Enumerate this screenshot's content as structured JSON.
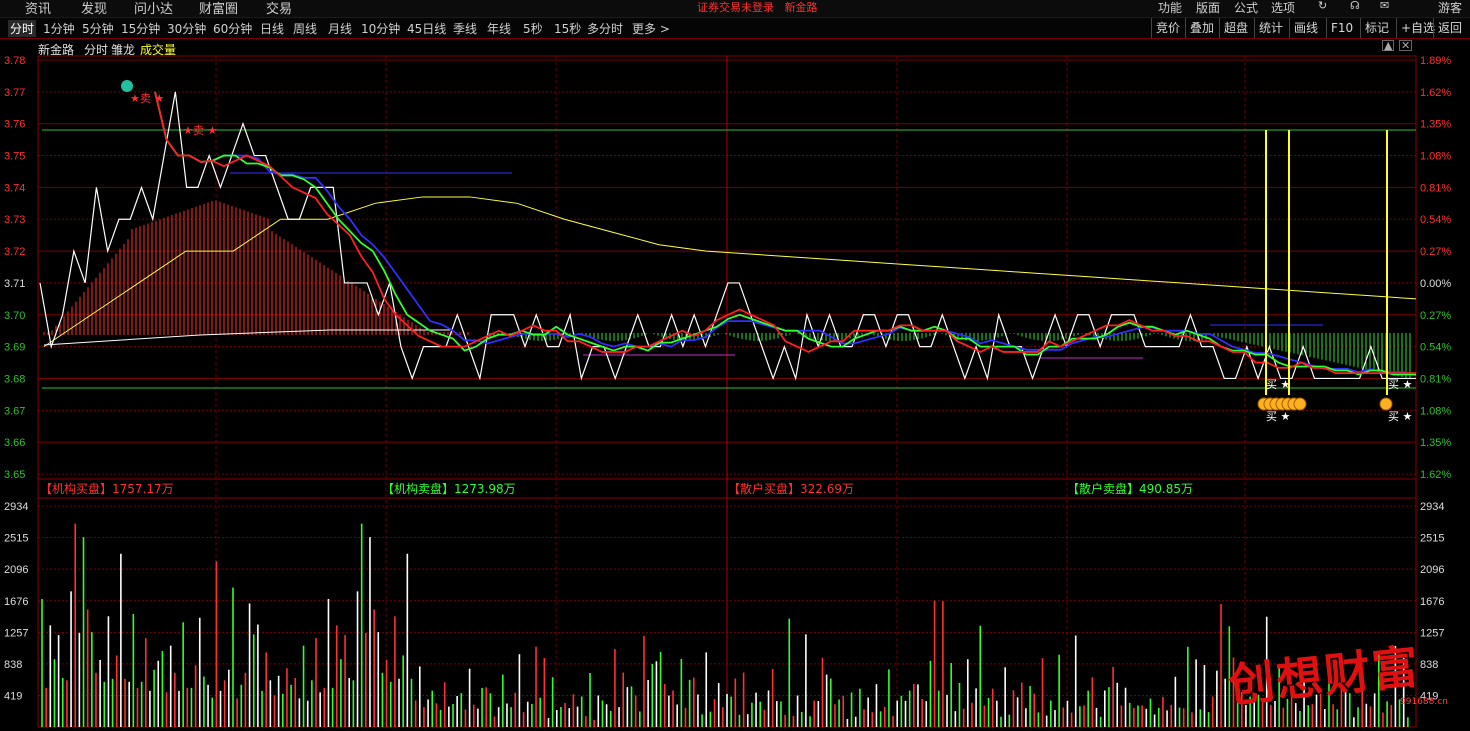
{
  "top_menu": {
    "left_items": [
      "资讯",
      "发现",
      "问小达",
      "财富圈",
      "交易"
    ],
    "warning": "证券交易未登录",
    "stock_name_link": "新金路",
    "right_items": [
      "功能",
      "版面",
      "公式",
      "选项",
      "游客"
    ]
  },
  "toolbar": {
    "timeframes": [
      "分时",
      "1分钟",
      "5分钟",
      "15分钟",
      "30分钟",
      "60分钟",
      "日线",
      "周线",
      "月线",
      "10分钟",
      "45日线",
      "季线",
      "年线",
      "5秒",
      "15秒",
      "多分时",
      "更多 >"
    ],
    "active": "分时",
    "right_buttons": [
      "竞价",
      "叠加",
      "超盘",
      "统计",
      "画线",
      "F10",
      "标记",
      "+自选",
      "返回"
    ]
  },
  "info_bar": {
    "stock": "新金路",
    "mode": "分时",
    "indicator": "雏龙",
    "volume_label": "成交量"
  },
  "price_axis": {
    "left": [
      "3.78",
      "3.77",
      "3.76",
      "3.75",
      "3.74",
      "3.73",
      "3.72",
      "3.71",
      "3.70",
      "3.69",
      "3.68",
      "3.67",
      "3.66",
      "3.65"
    ],
    "right": [
      "1.89%",
      "1.62%",
      "1.35%",
      "1.08%",
      "0.81%",
      "0.54%",
      "0.27%",
      "0.00%",
      "0.27%",
      "0.54%",
      "0.81%",
      "1.08%",
      "1.35%",
      "1.62%"
    ]
  },
  "volume_axis": [
    "2934",
    "2515",
    "2096",
    "1676",
    "1257",
    "838",
    "419"
  ],
  "flow_labels": [
    {
      "text": "【机构买盘】",
      "value": "1757.17万",
      "color": "#ff3030"
    },
    {
      "text": "【机构卖盘】",
      "value": "1273.98万",
      "color": "#30ff30"
    },
    {
      "text": "【散户买盘】",
      "value": "322.69万",
      "color": "#ff3030"
    },
    {
      "text": "【散户卖盘】",
      "value": "490.85万",
      "color": "#30ff30"
    }
  ],
  "signals": {
    "sell": "卖",
    "buy": "买",
    "star": "★"
  },
  "watermark": {
    "text": "创想财富",
    "url": "991688.cn"
  },
  "chart_data": {
    "type": "line",
    "prev_close": 3.71,
    "ylim": [
      3.65,
      3.78
    ],
    "price_series": [
      3.71,
      3.69,
      3.7,
      3.72,
      3.71,
      3.74,
      3.72,
      3.73,
      3.73,
      3.74,
      3.73,
      3.75,
      3.77,
      3.74,
      3.74,
      3.75,
      3.74,
      3.75,
      3.76,
      3.75,
      3.75,
      3.74,
      3.73,
      3.73,
      3.74,
      3.74,
      3.74,
      3.71,
      3.71,
      3.71,
      3.7,
      3.71,
      3.69,
      3.68,
      3.69,
      3.69,
      3.69,
      3.7,
      3.69,
      3.68,
      3.7,
      3.7,
      3.7,
      3.69,
      3.7,
      3.69,
      3.69,
      3.7,
      3.68,
      3.69,
      3.69,
      3.68,
      3.69,
      3.7,
      3.69,
      3.69,
      3.7,
      3.69,
      3.7,
      3.69,
      3.7,
      3.71,
      3.71,
      3.7,
      3.69,
      3.68,
      3.69,
      3.68,
      3.7,
      3.69,
      3.7,
      3.69,
      3.69,
      3.7,
      3.7,
      3.69,
      3.7,
      3.7,
      3.69,
      3.69,
      3.7,
      3.69,
      3.68,
      3.69,
      3.68,
      3.7,
      3.69,
      3.69,
      3.68,
      3.69,
      3.7,
      3.69,
      3.7,
      3.7,
      3.69,
      3.7,
      3.7,
      3.7,
      3.69,
      3.69,
      3.69,
      3.69,
      3.7,
      3.69,
      3.69,
      3.68,
      3.68,
      3.69,
      3.68,
      3.69,
      3.68,
      3.68,
      3.69,
      3.68,
      3.68,
      3.68,
      3.68,
      3.68,
      3.69,
      3.68,
      3.68,
      3.68,
      3.68
    ],
    "avg_price": [
      3.69,
      3.7,
      3.71,
      3.72,
      3.72,
      3.73,
      3.73,
      3.735,
      3.737,
      3.737,
      3.735,
      3.73,
      3.726,
      3.722,
      3.72,
      3.719,
      3.718,
      3.717,
      3.716,
      3.715,
      3.714,
      3.713,
      3.712,
      3.711,
      3.71,
      3.709,
      3.708,
      3.707,
      3.706,
      3.705
    ],
    "volume": [
      1700,
      520,
      1350,
      900,
      1220,
      650,
      620,
      1800,
      2700,
      1250,
      2520,
      1560,
      1260,
      720,
      890,
      600,
      1470,
      640,
      950,
      2300,
      640,
      600,
      1500,
      520,
      600,
      1180,
      480,
      760,
      880,
      1010,
      460,
      1080,
      720,
      480,
      1390,
      520,
      520,
      820,
      1450,
      670,
      560,
      390,
      2200,
      480,
      620,
      760,
      1850,
      380,
      560,
      720,
      1640,
      1230,
      1360,
      480,
      990,
      620,
      420,
      680,
      440,
      780,
      560,
      650,
      380,
      1080,
      350,
      620,
      1180,
      460,
      520
    ]
  }
}
